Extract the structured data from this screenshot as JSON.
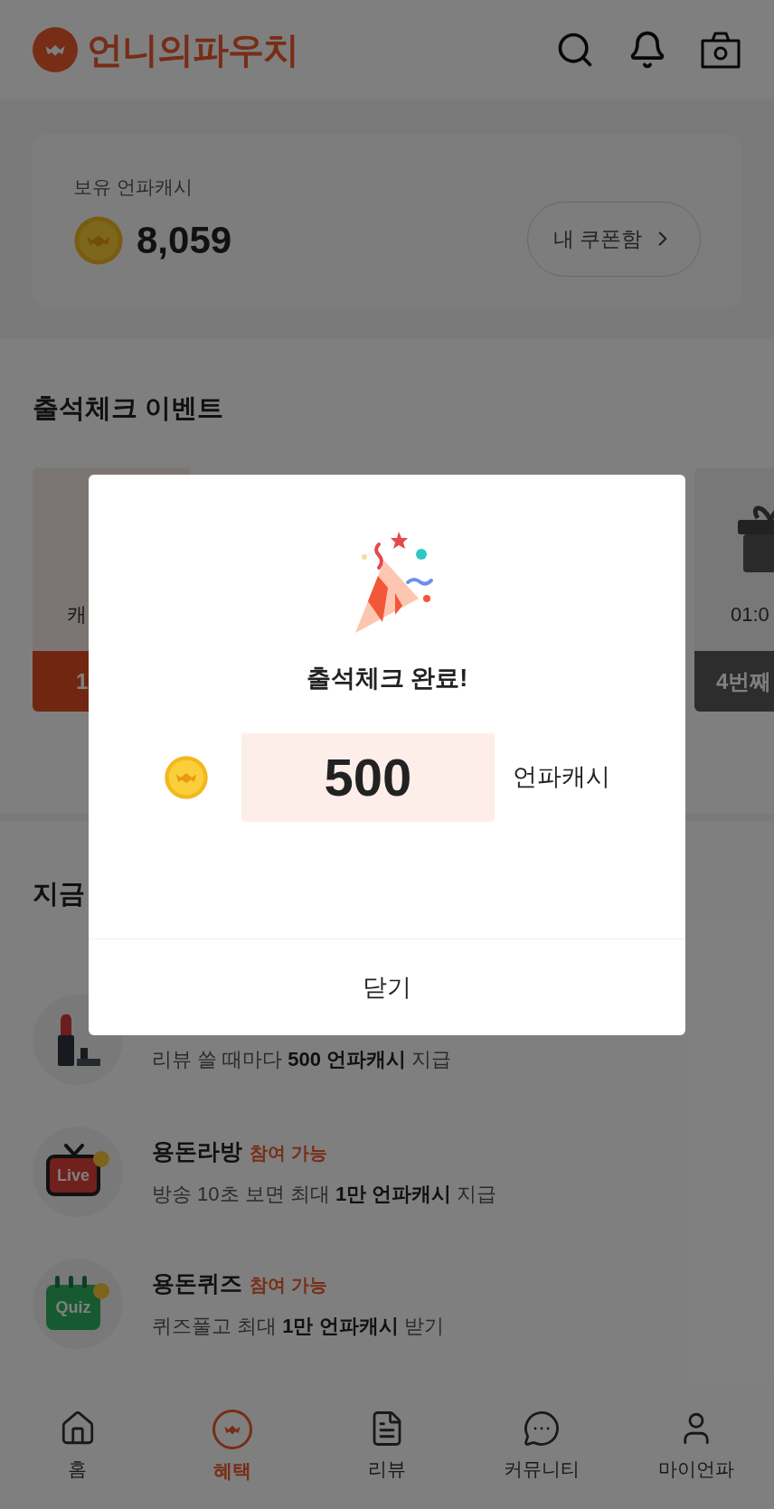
{
  "header": {
    "logo": "언니의파우치"
  },
  "cash_card": {
    "label": "보유 언파캐시",
    "amount": "8,059",
    "coupon_button": "내 쿠폰함"
  },
  "attendance": {
    "title": "출석체크 이벤트",
    "cards": [
      {
        "kind": "reward",
        "text": "캐",
        "button": "1",
        "selected": true
      },
      {
        "kind": "gift",
        "text": "01:0",
        "button": "4번째",
        "selected": false
      }
    ]
  },
  "events": {
    "title": "지금",
    "items": [
      {
        "kind": "review",
        "description": "리뷰 쓸 때마다 **500 언파캐시** 지급"
      },
      {
        "kind": "live",
        "icon_text": "Live",
        "title": "용돈라방",
        "badge": "참여 가능",
        "description": "방송 10초 보면 최대 **1만 언파캐시** 지급"
      },
      {
        "kind": "quiz",
        "icon_text": "Quiz",
        "title": "용돈퀴즈",
        "badge": "참여 가능",
        "description": "퀴즈풀고 최대 **1만 언파캐시** 받기"
      }
    ]
  },
  "bottom_nav": [
    {
      "kind": "home",
      "label": "홈",
      "selected": false
    },
    {
      "kind": "benefit",
      "label": "혜택",
      "selected": true
    },
    {
      "kind": "review",
      "label": "리뷰",
      "selected": false
    },
    {
      "kind": "community",
      "label": "커뮤니티",
      "selected": false
    },
    {
      "kind": "my",
      "label": "마이언파",
      "selected": false
    }
  ],
  "dialog": {
    "title": "출석체크 완료!",
    "amount": "500",
    "unit": "언파캐시",
    "close_button": "닫기"
  }
}
